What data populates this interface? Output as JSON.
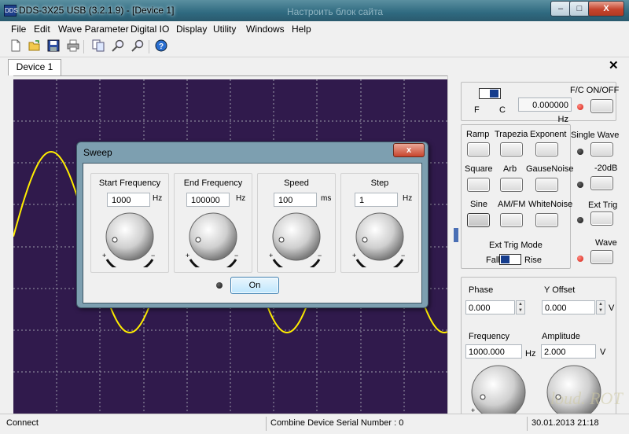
{
  "window": {
    "title": "DDS-3X25 USB (3.2.1.9) - [Device 1]",
    "background_title": "Настроить блок сайта",
    "min_label": "–",
    "max_label": "□",
    "close_label": "X",
    "app_icon": "DDS"
  },
  "menu": {
    "items": [
      "File",
      "Edit",
      "Wave Parameter",
      "Digital IO",
      "Display",
      "Utility",
      "Windows",
      "Help"
    ]
  },
  "toolbar": {
    "icons": [
      "new-icon",
      "open-icon",
      "save-icon",
      "print-icon",
      "copy-icon",
      "zoom-in-icon",
      "zoom-out-icon",
      "help-icon"
    ]
  },
  "tabs": {
    "active": "Device 1",
    "close_label": "✕"
  },
  "scope": {
    "background": "#301a4c",
    "grid_color": "#9c9caa",
    "wave_color": "#ffee00"
  },
  "right_panel": {
    "fc": {
      "f_label": "F",
      "c_label": "C",
      "onoff_label": "F/C ON/OFF",
      "frequency_value": "0.000000 Hz"
    },
    "wave_buttons": {
      "ramp": "Ramp",
      "trapezia": "Trapezia",
      "exponent": "Exponent",
      "square": "Square",
      "arb": "Arb",
      "gause_noise": "GauseNoise",
      "sine": "Sine",
      "am_fm": "AM/FM",
      "white_noise": "WhiteNoise"
    },
    "side": {
      "single_wave": "Single Wave",
      "minus20db": "-20dB",
      "ext_trig": "Ext Trig",
      "wave": "Wave"
    },
    "ext_trig_mode": {
      "title": "Ext Trig Mode",
      "fall": "Fall",
      "rise": "Rise"
    },
    "params": {
      "phase_label": "Phase",
      "phase_value": "0.000",
      "yoffset_label": "Y Offset",
      "yoffset_value": "0.000",
      "yoffset_unit": "V",
      "frequency_label": "Frequency",
      "frequency_value": "1000.000",
      "frequency_unit": "Hz",
      "amplitude_label": "Amplitude",
      "amplitude_value": "2.000",
      "amplitude_unit": "V"
    }
  },
  "sweep_dialog": {
    "title": "Sweep",
    "close_label": "x",
    "on_label": "On",
    "groups": [
      {
        "title": "Start Frequency",
        "value": "1000",
        "unit": "Hz"
      },
      {
        "title": "End Frequency",
        "value": "100000",
        "unit": "Hz"
      },
      {
        "title": "Speed",
        "value": "100",
        "unit": "ms"
      },
      {
        "title": "Step",
        "value": "1",
        "unit": "Hz"
      }
    ]
  },
  "statusbar": {
    "connect": "Connect",
    "serial": "Combine Device Serial Number : 0",
    "datetime": "30.01.2013 21:18"
  },
  "watermark": "loud. ROT"
}
